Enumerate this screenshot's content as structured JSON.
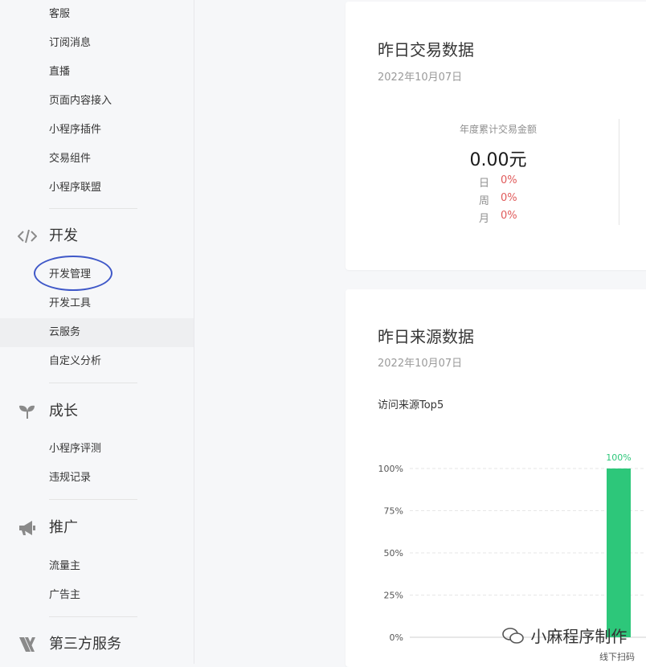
{
  "sidebar": {
    "top_items": [
      "客服",
      "订阅消息",
      "直播",
      "页面内容接入",
      "小程序插件",
      "交易组件",
      "小程序联盟"
    ],
    "sections": [
      {
        "label": "开发",
        "icon": "code-icon",
        "items": [
          "开发管理",
          "开发工具",
          "云服务",
          "自定义分析"
        ]
      },
      {
        "label": "成长",
        "icon": "sprout-icon",
        "items": [
          "小程序评测",
          "违规记录"
        ]
      },
      {
        "label": "推广",
        "icon": "megaphone-icon",
        "items": [
          "流量主",
          "广告主"
        ]
      },
      {
        "label": "第三方服务",
        "icon": "third-party-icon",
        "items": []
      }
    ],
    "active_item": "云服务",
    "circled_item": "开发管理"
  },
  "trade_card": {
    "title": "昨日交易数据",
    "date": "2022年10月07日",
    "metric_label": "年度累计交易金额",
    "metric_value": "0.00元",
    "rows": [
      {
        "label": "日",
        "value": "0%"
      },
      {
        "label": "周",
        "value": "0%"
      },
      {
        "label": "月",
        "value": "0%"
      }
    ]
  },
  "source_card": {
    "title": "昨日来源数据",
    "date": "2022年10月07日",
    "subtitle": "访问来源Top5"
  },
  "chart_data": {
    "type": "bar",
    "title": "访问来源Top5",
    "y_ticks": [
      "100%",
      "75%",
      "50%",
      "25%",
      "0%"
    ],
    "ylim": [
      0,
      100
    ],
    "categories": [
      ""
    ],
    "values": [
      100
    ],
    "data_labels": [
      "100%"
    ],
    "grid": true,
    "color": "#2dc77a"
  },
  "overlay": {
    "watermark": "小麻程序制作",
    "qr_note": "线下扫码"
  }
}
